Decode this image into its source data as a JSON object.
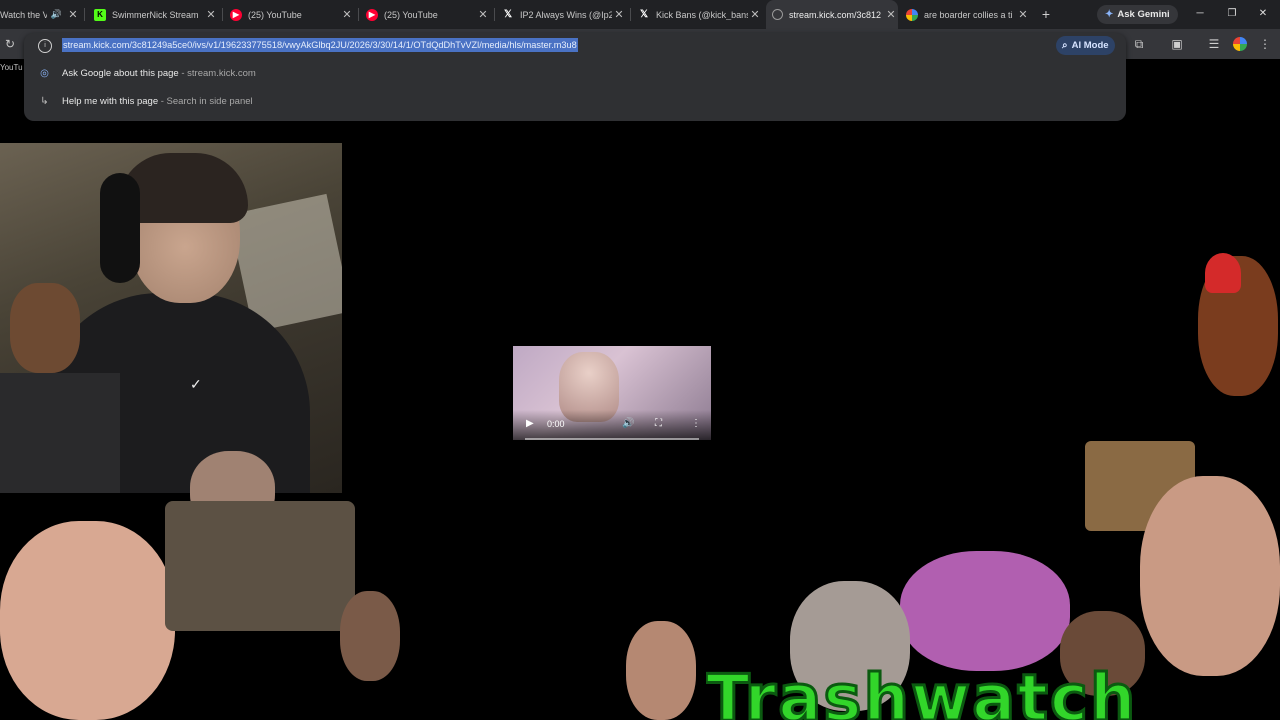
{
  "tabs": [
    {
      "title": "Watch the V",
      "favicon": "audio-icon",
      "active": false
    },
    {
      "title": "SwimmerNick Stream",
      "favicon": "kick-icon",
      "active": false
    },
    {
      "title": "(25) YouTube",
      "favicon": "youtube-icon",
      "active": false
    },
    {
      "title": "(25) YouTube",
      "favicon": "youtube-icon",
      "active": false
    },
    {
      "title": "IP2 Always Wins (@Ip2",
      "favicon": "x-icon",
      "active": false
    },
    {
      "title": "Kick Bans (@kick_bans",
      "favicon": "x-icon",
      "active": false
    },
    {
      "title": "stream.kick.com/3c812",
      "favicon": "globe-icon",
      "active": true
    },
    {
      "title": "are boarder collies a ti",
      "favicon": "google-icon",
      "active": false
    }
  ],
  "gemini_button": "Ask Gemini",
  "address_bar": {
    "url": "stream.kick.com/3c81249a5ce0/ivs/v1/196233775518/vwyAkGlbq2JU/2026/3/30/14/1/OTdQdDhTvVZl/media/hls/master.m3u8",
    "ai_mode_label": "AI Mode"
  },
  "suggestions": [
    {
      "text": "Ask Google about this page",
      "sub": " - stream.kick.com",
      "icon": "google-lens-icon"
    },
    {
      "text": "Help me with this page",
      "sub": " - Search in side panel",
      "icon": "arrow-return-icon"
    }
  ],
  "bookmark_stub": "YouTu",
  "video_player": {
    "time": "0:00"
  },
  "overlay_title": "Trashwatch",
  "colors": {
    "tabstrip": "#202124",
    "toolbar": "#35363a",
    "url_highlight": "#4a72c4",
    "overlay_green": "#32d62a"
  }
}
